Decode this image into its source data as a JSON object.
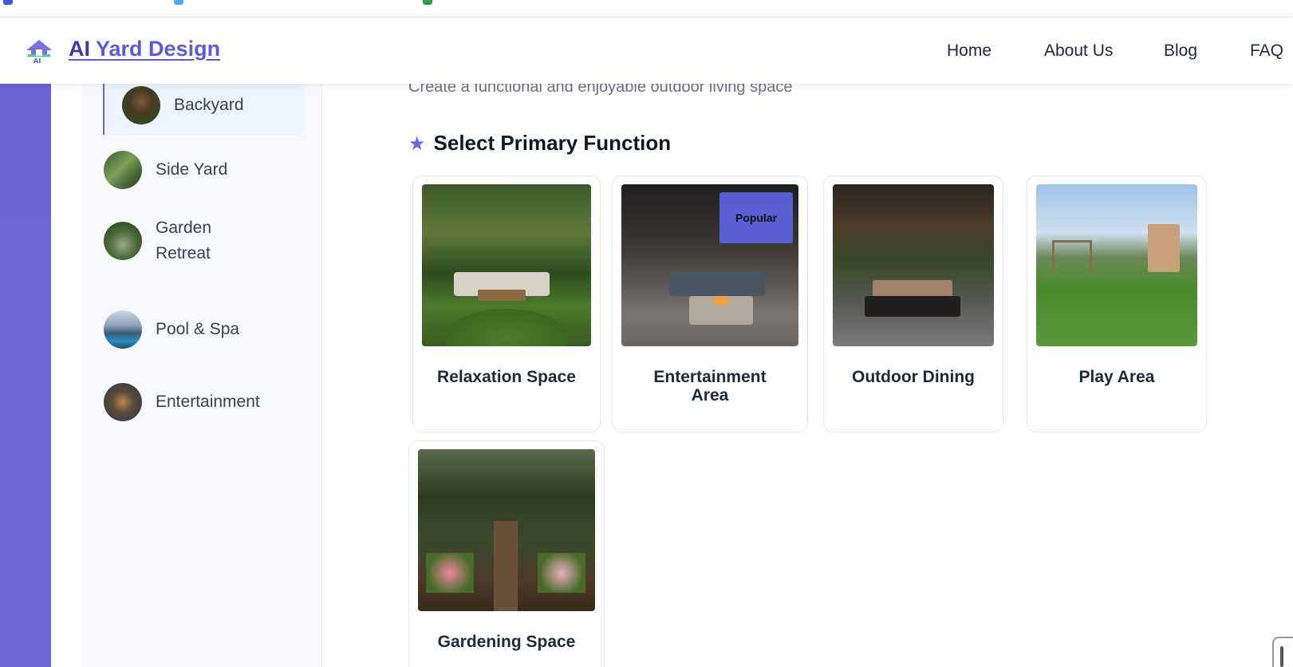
{
  "header": {
    "logo_prefix": "AI",
    "logo_rest": "Yard Design",
    "nav": [
      "Home",
      "About Us",
      "Blog",
      "FAQ"
    ]
  },
  "sidebar": {
    "items": [
      {
        "label": "Backyard",
        "active": true
      },
      {
        "label": "Side Yard",
        "active": false
      },
      {
        "label": "Garden Retreat",
        "active": false
      },
      {
        "label": "Pool & Spa",
        "active": false
      },
      {
        "label": "Entertainment",
        "active": false
      }
    ]
  },
  "main": {
    "subtitle": "Create a functional and enjoyable outdoor living space",
    "section_title": "Select Primary Function",
    "cards": [
      {
        "label": "Relaxation Space"
      },
      {
        "label": "Entertainment Area",
        "badge": "Popular"
      },
      {
        "label": "Outdoor Dining"
      },
      {
        "label": "Play Area"
      },
      {
        "label": "Gardening Space"
      }
    ]
  },
  "colors": {
    "accent": "#6366f1",
    "sidebar_bg": "#f7f9fc",
    "active_bg": "#eef4fe",
    "stripe": "#6d62d6"
  }
}
